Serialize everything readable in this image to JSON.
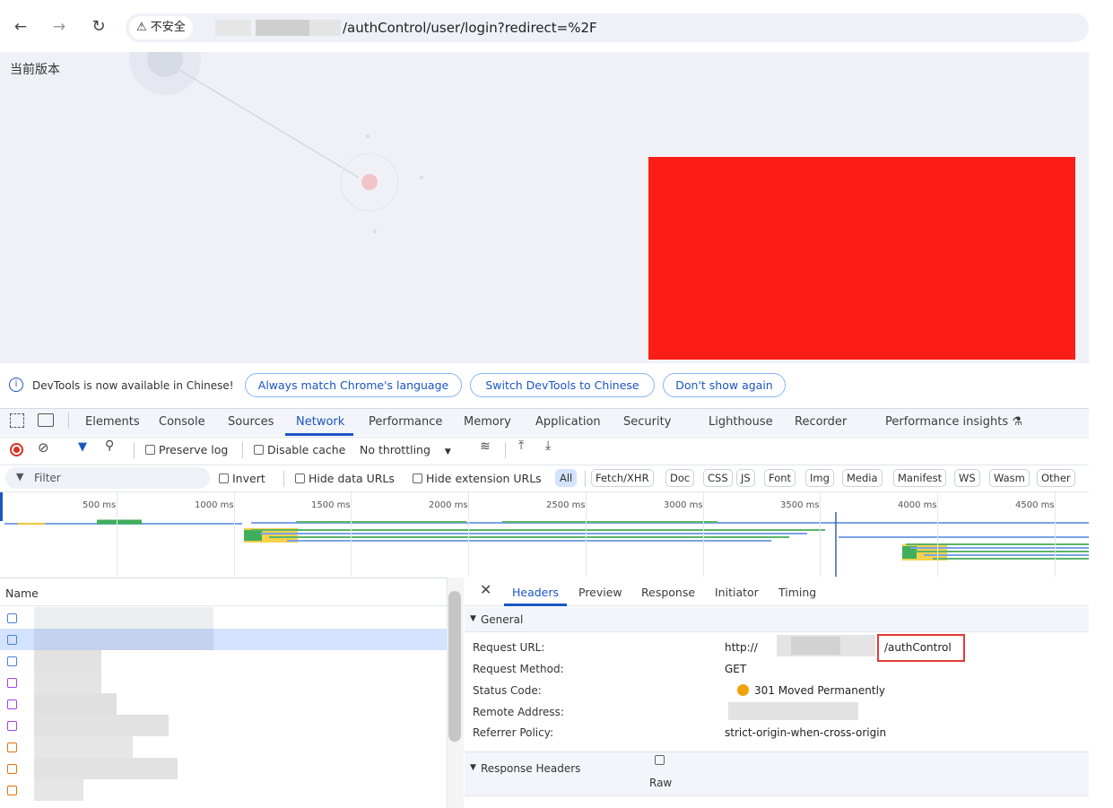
{
  "browser": {
    "security_label": "不安全",
    "url_path": "/authControl/user/login?redirect=%2F"
  },
  "page": {
    "version_label": "当前版本"
  },
  "devtools": {
    "infobar": {
      "message": "DevTools is now available in Chinese!",
      "btn_match": "Always match Chrome's language",
      "btn_switch": "Switch DevTools to Chinese",
      "btn_dismiss": "Don't show again"
    },
    "tabs": {
      "elements": "Elements",
      "console": "Console",
      "sources": "Sources",
      "network": "Network",
      "performance": "Performance",
      "memory": "Memory",
      "application": "Application",
      "security": "Security",
      "lighthouse": "Lighthouse",
      "recorder": "Recorder",
      "perf_insights": "Performance insights"
    },
    "toolbar": {
      "preserve_log": "Preserve log",
      "disable_cache": "Disable cache",
      "throttling": "No throttling"
    },
    "filterbar": {
      "filter_placeholder": "Filter",
      "invert": "Invert",
      "hide_data": "Hide data URLs",
      "hide_ext": "Hide extension URLs",
      "types": [
        "All",
        "Fetch/XHR",
        "Doc",
        "CSS",
        "JS",
        "Font",
        "Img",
        "Media",
        "Manifest",
        "WS",
        "Wasm",
        "Other"
      ]
    },
    "timeline_ticks": [
      "500 ms",
      "1000 ms",
      "1500 ms",
      "2000 ms",
      "2500 ms",
      "3000 ms",
      "3500 ms",
      "4000 ms",
      "4500 ms"
    ],
    "name_header": "Name",
    "detail_tabs": {
      "headers": "Headers",
      "preview": "Preview",
      "response": "Response",
      "initiator": "Initiator",
      "timing": "Timing"
    },
    "general": {
      "title": "General",
      "request_url_label": "Request URL:",
      "request_url_prefix": "http://",
      "request_url_suffix": "/authControl",
      "request_method_label": "Request Method:",
      "request_method": "GET",
      "status_code_label": "Status Code:",
      "status_code": "301 Moved Permanently",
      "remote_address_label": "Remote Address:",
      "referrer_policy_label": "Referrer Policy:",
      "referrer_policy": "strict-origin-when-cross-origin"
    },
    "response_headers": {
      "title": "Response Headers",
      "raw": "Raw"
    },
    "colors": {
      "accent": "#1a56c4",
      "highlight": "#e53935",
      "status_301": "#f0a30a"
    }
  }
}
